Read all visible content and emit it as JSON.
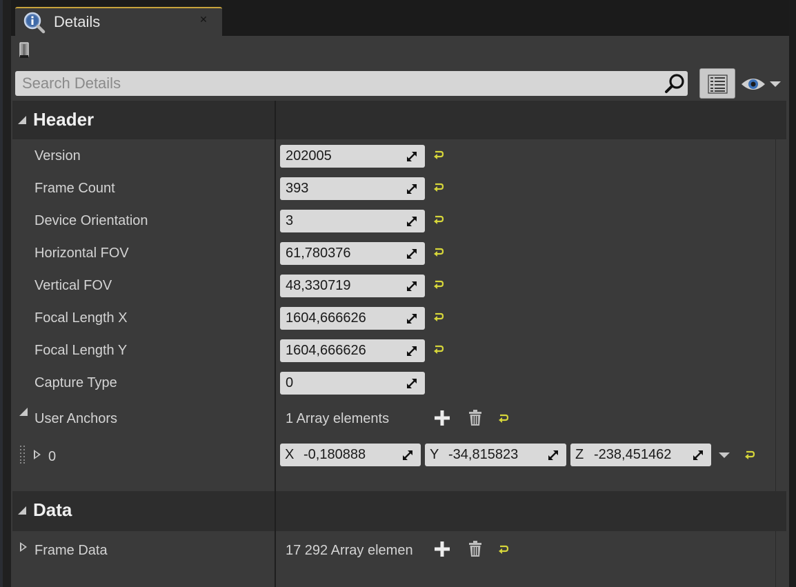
{
  "tab": {
    "title": "Details"
  },
  "search": {
    "placeholder": "Search Details"
  },
  "categories": {
    "header": "Header",
    "data": "Data"
  },
  "header_props": [
    {
      "label": "Version",
      "value": "202005",
      "resettable": true
    },
    {
      "label": "Frame Count",
      "value": "393",
      "resettable": true
    },
    {
      "label": "Device Orientation",
      "value": "3",
      "resettable": true
    },
    {
      "label": "Horizontal FOV",
      "value": "61,780376",
      "resettable": true
    },
    {
      "label": "Vertical FOV",
      "value": "48,330719",
      "resettable": true
    },
    {
      "label": "Focal Length X",
      "value": "1604,666626",
      "resettable": true
    },
    {
      "label": "Focal Length Y",
      "value": "1604,666626",
      "resettable": true
    },
    {
      "label": "Capture Type",
      "value": "0",
      "resettable": false
    }
  ],
  "user_anchors": {
    "label": "User Anchors",
    "count_text": "1 Array elements",
    "element": {
      "index": "0",
      "x_axis": "X",
      "x": "-0,180888",
      "y_axis": "Y",
      "y": "-34,815823",
      "z_axis": "Z",
      "z": "-238,451462"
    }
  },
  "frame_data": {
    "label": "Frame Data",
    "count_text": "17 292 Array elemen"
  },
  "colors": {
    "panel_bg": "#3a3a3a",
    "category_bg": "#2d2d2d",
    "field_bg": "#d9d9d9",
    "reset_accent": "#d6d63a",
    "tab_accent": "#c9a43c"
  },
  "icons": {
    "tab": "details-magnifier-icon",
    "toolbar": "lock-icon",
    "search": "search-icon",
    "view": "view-options-icon",
    "eye": "eye-icon",
    "reset": "reset-to-default-icon",
    "add": "plus-icon",
    "delete": "trash-icon"
  }
}
